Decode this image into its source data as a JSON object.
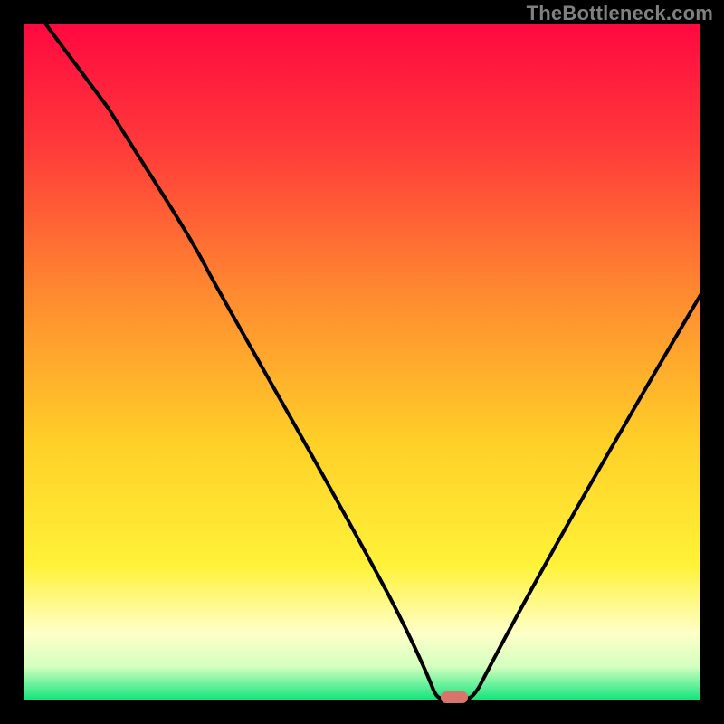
{
  "watermark": "TheBottleneck.com",
  "colors": {
    "black": "#000000",
    "curve": "#000000",
    "marker": "#d9746c",
    "gradient_top": "#ff0840",
    "gradient_mid1": "#ff5a3a",
    "gradient_mid2": "#ffb030",
    "gradient_mid3": "#ffe428",
    "gradient_pale": "#fffac0",
    "gradient_green": "#14e07c"
  },
  "chart_data": {
    "type": "line",
    "title": "",
    "xlabel": "",
    "ylabel": "",
    "xlim": [
      0,
      100
    ],
    "ylim": [
      0,
      100
    ],
    "grid": false,
    "series": [
      {
        "name": "bottleneck-curve",
        "x": [
          3,
          10,
          20,
          27,
          35,
          45,
          55,
          58,
          60,
          62,
          64,
          70,
          80,
          90,
          100
        ],
        "y": [
          100,
          88,
          72,
          62,
          50,
          34,
          14,
          5,
          1,
          0,
          0,
          8,
          26,
          44,
          60
        ]
      }
    ],
    "marker": {
      "x": 62,
      "y": 0,
      "width": 4,
      "height": 2
    },
    "legend": null
  }
}
